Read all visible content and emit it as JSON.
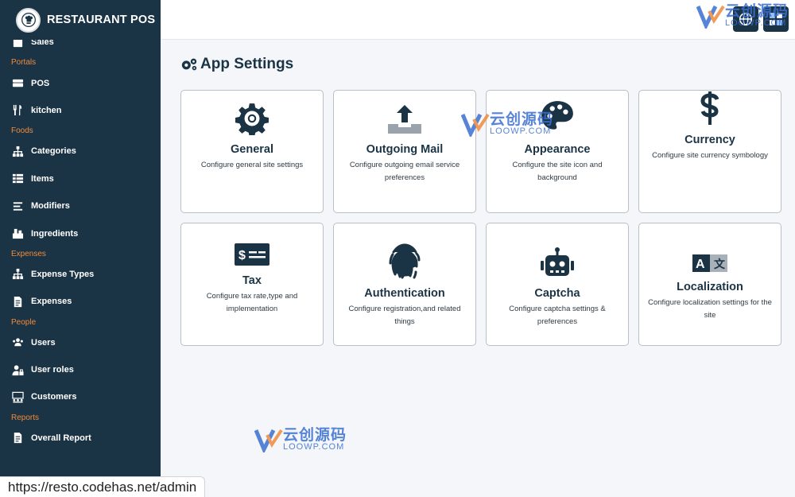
{
  "app": {
    "title": "RESTAURANT POS"
  },
  "sidebar": {
    "partial_item": "Sales",
    "sections": {
      "portals": "Portals",
      "foods": "Foods",
      "expenses": "Expenses",
      "people": "People",
      "reports": "Reports"
    },
    "items": {
      "pos": "POS",
      "kitchen": "kitchen",
      "categories": "Categories",
      "items": "Items",
      "modifiers": "Modifiers",
      "ingredients": "Ingredients",
      "expense_types": "Expense Types",
      "expenses": "Expenses",
      "users": "Users",
      "user_roles": "User roles",
      "customers": "Customers",
      "overall_report": "Overall Report"
    }
  },
  "page": {
    "title": "App Settings"
  },
  "cards": {
    "general": {
      "title": "General",
      "desc": "Configure general site settings",
      "icon": "gear-icon"
    },
    "outgoing_mail": {
      "title": "Outgoing Mail",
      "desc": "Configure outgoing email service preferences",
      "icon": "upload-tray-icon"
    },
    "appearance": {
      "title": "Appearance",
      "desc": "Configure the site icon and background",
      "icon": "palette-icon"
    },
    "currency": {
      "title": "Currency",
      "desc": "Configure site currency symbology",
      "icon": "dollar-icon"
    },
    "tax": {
      "title": "Tax",
      "desc": "Configure tax rate,type and implementation",
      "icon": "money-check-icon"
    },
    "authentication": {
      "title": "Authentication",
      "desc": "Configure registration,and related things",
      "icon": "fingerprint-icon"
    },
    "captcha": {
      "title": "Captcha",
      "desc": "Configure captcha settings & preferences",
      "icon": "robot-icon"
    },
    "localization": {
      "title": "Localization",
      "desc": "Configure localization settings for the site",
      "icon": "language-icon"
    }
  },
  "status_bar": {
    "url": "https://resto.codehas.net/admin"
  },
  "watermark": {
    "cn": "云创源码",
    "en": "LOOWP.COM"
  },
  "colors": {
    "sidebar": "#1b3445",
    "section_label": "#f08a3c",
    "background": "#f4f6f9"
  }
}
